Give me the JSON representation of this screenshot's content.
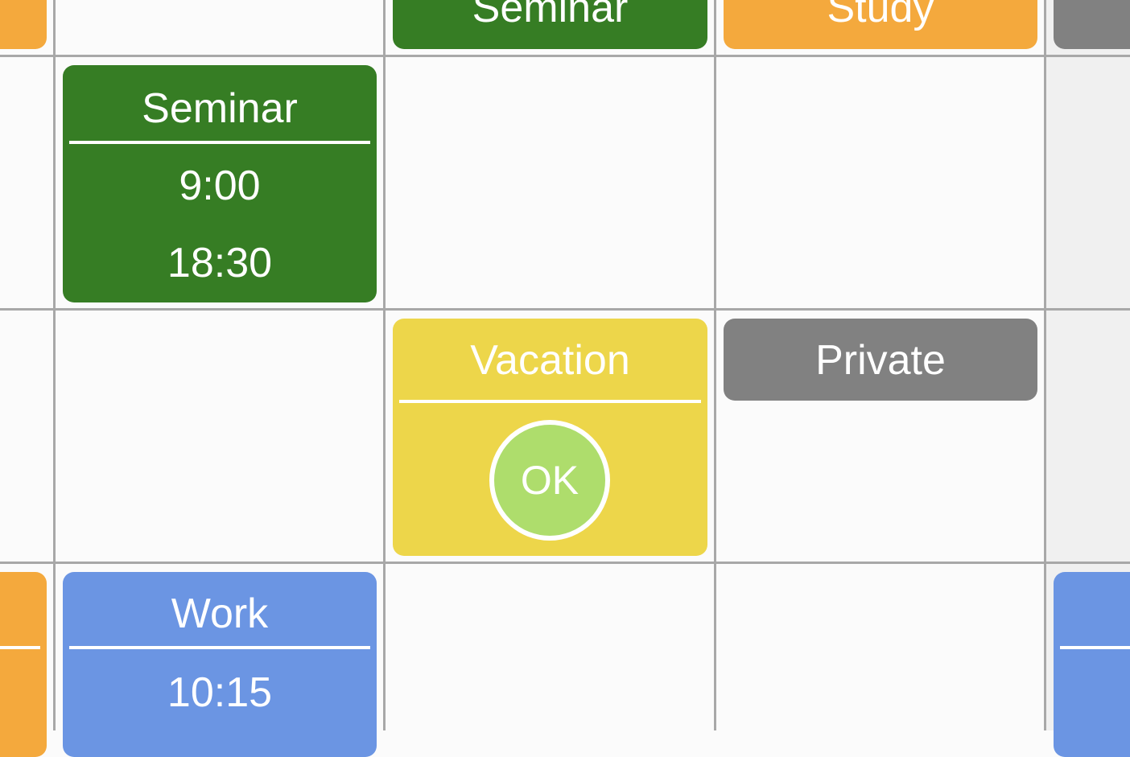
{
  "events": {
    "seminar_top": {
      "title": "Seminar"
    },
    "study_top": {
      "title": "Study"
    },
    "seminar": {
      "title": "Seminar",
      "start": "9:00",
      "end": "18:30"
    },
    "vacation": {
      "title": "Vacation",
      "ok_label": "OK"
    },
    "private": {
      "title": "Private"
    },
    "work": {
      "title": "Work",
      "start": "10:15"
    }
  },
  "colors": {
    "seminar": "#367d24",
    "study": "#f4a93d",
    "private": "#818181",
    "vacation": "#edd64a",
    "work": "#6b95e3",
    "ok_button": "#aedd6c",
    "grid_line": "#a8a8a8"
  }
}
